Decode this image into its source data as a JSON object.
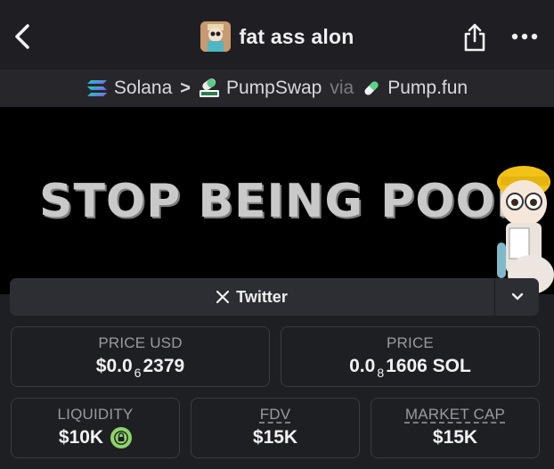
{
  "header": {
    "title": "fat ass alon",
    "icons": {
      "back": "chevron-left-icon",
      "share": "share-icon",
      "more": "more-dots-icon"
    }
  },
  "breadcrumb": {
    "chain": "Solana",
    "separator": ">",
    "dex": "PumpSwap",
    "via_label": "via",
    "launchpad": "Pump.fun"
  },
  "banner": {
    "text": "STOP BEING POOR"
  },
  "social": {
    "twitter_label": "Twitter",
    "icons": {
      "twitter": "x-logo-icon",
      "expand": "chevron-down-icon"
    }
  },
  "stats": {
    "price_usd": {
      "label": "PRICE USD",
      "prefix": "$0.0",
      "zeros": "6",
      "digits": "2379"
    },
    "price": {
      "label": "PRICE",
      "prefix": "0.0",
      "zeros": "8",
      "digits": "1606 SOL"
    },
    "liquidity": {
      "label": "LIQUIDITY",
      "value": "$10K"
    },
    "fdv": {
      "label": "FDV",
      "value": "$15K"
    },
    "market_cap": {
      "label": "MARKET CAP",
      "value": "$15K"
    }
  },
  "colors": {
    "background": "#1e1f22",
    "bar": "#2d2e33",
    "liquidity_lock": "#8fd36b"
  }
}
